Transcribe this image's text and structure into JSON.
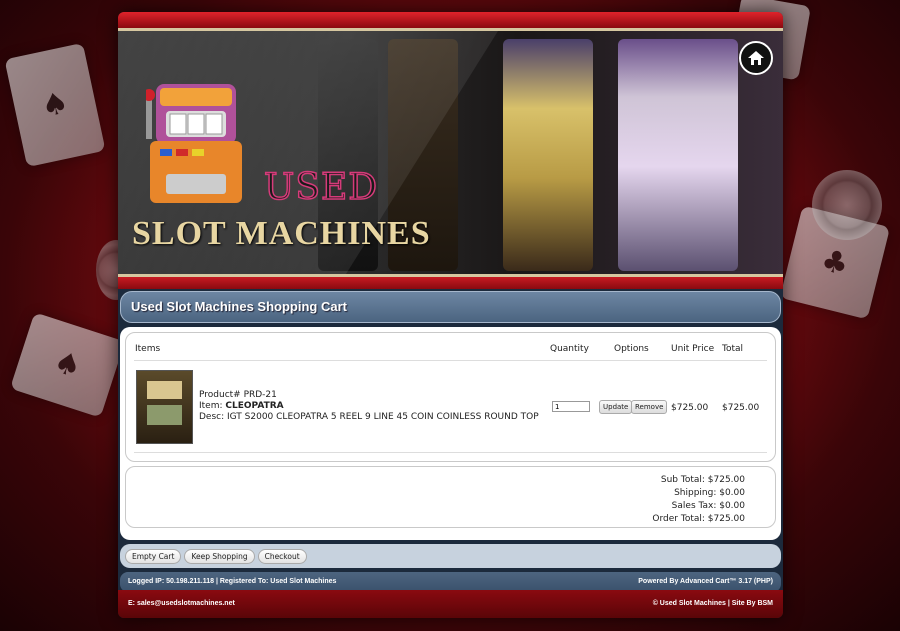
{
  "banner": {
    "logo_top": "USED",
    "logo_bottom": "SLOT MACHINES"
  },
  "cart": {
    "title": "Used Slot Machines Shopping Cart",
    "columns": {
      "items": "Items",
      "quantity": "Quantity",
      "options": "Options",
      "unit_price": "Unit Price",
      "total": "Total"
    },
    "item": {
      "product_line": "Product# PRD-21",
      "item_label": "Item:",
      "item_name": "CLEOPATRA",
      "desc_line": "Desc: IGT S2000 CLEOPATRA 5 REEL 9 LINE 45 COIN COINLESS ROUND TOP",
      "quantity": "1",
      "update_label": "Update",
      "remove_label": "Remove",
      "unit_price": "$725.00",
      "total": "$725.00"
    },
    "totals": {
      "sub_total": "Sub Total: $725.00",
      "shipping": "Shipping: $0.00",
      "sales_tax": "Sales Tax: $0.00",
      "order_total": "Order Total: $725.00"
    },
    "actions": {
      "empty": "Empty Cart",
      "keep": "Keep Shopping",
      "checkout": "Checkout"
    }
  },
  "infobar": {
    "left": "Logged IP: 50.198.211.118 | Registered To: Used Slot Machines",
    "right": "Powered By Advanced Cart™ 3.17 (PHP)"
  },
  "footer": {
    "left": "E: sales@usedslotmachines.net",
    "right": "© Used Slot Machines   |   Site By BSM"
  }
}
